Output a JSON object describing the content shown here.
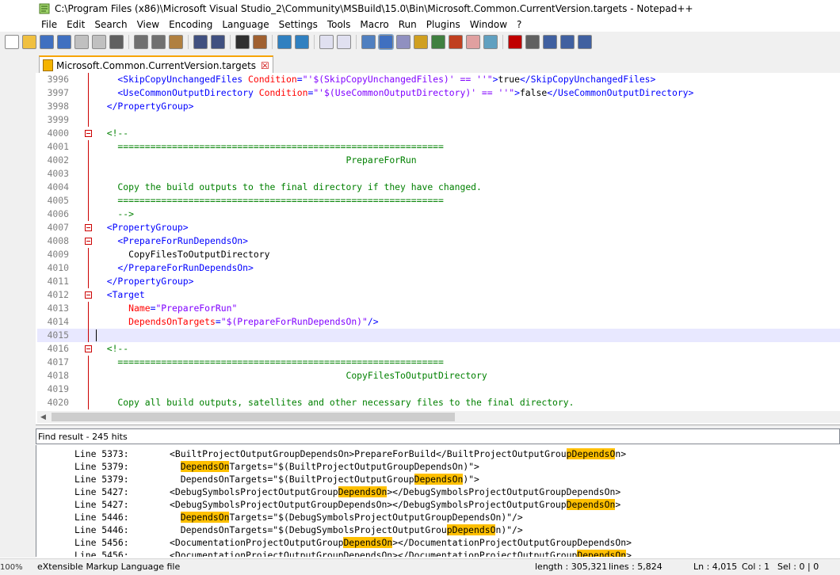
{
  "window": {
    "title": "C:\\Program Files (x86)\\Microsoft Visual Studio_2\\Community\\MSBuild\\15.0\\Bin\\Microsoft.Common.CurrentVersion.targets - Notepad++"
  },
  "menu": [
    "File",
    "Edit",
    "Search",
    "View",
    "Encoding",
    "Language",
    "Settings",
    "Tools",
    "Macro",
    "Run",
    "Plugins",
    "Window",
    "?"
  ],
  "toolbar": {
    "icons": [
      "new-file-icon",
      "open-file-icon",
      "save-icon",
      "save-all-icon",
      "close-icon",
      "close-all-icon",
      "print-icon",
      "cut-icon",
      "copy-icon",
      "paste-icon",
      "undo-icon",
      "redo-icon",
      "find-icon",
      "replace-icon",
      "zoom-in-icon",
      "zoom-out-icon",
      "sync-vertical-icon",
      "sync-horizontal-icon",
      "word-wrap-icon",
      "show-all-chars-icon",
      "indent-guide-icon",
      "language-icon",
      "doc-map-icon",
      "function-list-icon",
      "folder-workspace-icon",
      "monitoring-icon",
      "record-macro-icon",
      "stop-record-icon",
      "play-macro-icon",
      "run-macro-multiple-icon",
      "save-macro-icon"
    ]
  },
  "tab": {
    "label": "Microsoft.Common.CurrentVersion.targets"
  },
  "editor": {
    "lines": [
      {
        "n": "3996",
        "fold": "line",
        "parts": [
          {
            "c": "tag",
            "t": "    <SkipCopyUnchangedFiles "
          },
          {
            "c": "attr",
            "t": "Condition"
          },
          {
            "c": "tag",
            "t": "="
          },
          {
            "c": "val",
            "t": "\"'$(SkipCopyUnchangedFiles)' == ''\""
          },
          {
            "c": "tag",
            "t": ">"
          },
          {
            "c": "txt",
            "t": "true"
          },
          {
            "c": "tag",
            "t": "</SkipCopyUnchangedFiles>"
          }
        ]
      },
      {
        "n": "3997",
        "fold": "line",
        "parts": [
          {
            "c": "tag",
            "t": "    <UseCommonOutputDirectory "
          },
          {
            "c": "attr",
            "t": "Condition"
          },
          {
            "c": "tag",
            "t": "="
          },
          {
            "c": "val",
            "t": "\"'$(UseCommonOutputDirectory)' == ''\""
          },
          {
            "c": "tag",
            "t": ">"
          },
          {
            "c": "txt",
            "t": "false"
          },
          {
            "c": "tag",
            "t": "</UseCommonOutputDirectory>"
          }
        ]
      },
      {
        "n": "3998",
        "fold": "line",
        "parts": [
          {
            "c": "tag",
            "t": "  </PropertyGroup>"
          }
        ]
      },
      {
        "n": "3999",
        "fold": "line",
        "parts": []
      },
      {
        "n": "4000",
        "fold": "box",
        "parts": [
          {
            "c": "cmt",
            "t": "  <!--"
          }
        ]
      },
      {
        "n": "4001",
        "fold": "line",
        "parts": [
          {
            "c": "cmt",
            "t": "    ============================================================"
          }
        ]
      },
      {
        "n": "4002",
        "fold": "line",
        "parts": [
          {
            "c": "cmt",
            "t": "                                              PrepareForRun"
          }
        ]
      },
      {
        "n": "4003",
        "fold": "line",
        "parts": []
      },
      {
        "n": "4004",
        "fold": "line",
        "parts": [
          {
            "c": "cmt",
            "t": "    Copy the build outputs to the final directory if they have changed."
          }
        ]
      },
      {
        "n": "4005",
        "fold": "line",
        "parts": [
          {
            "c": "cmt",
            "t": "    ============================================================"
          }
        ]
      },
      {
        "n": "4006",
        "fold": "line",
        "parts": [
          {
            "c": "cmt",
            "t": "    -->"
          }
        ]
      },
      {
        "n": "4007",
        "fold": "box",
        "parts": [
          {
            "c": "tag",
            "t": "  <PropertyGroup>"
          }
        ]
      },
      {
        "n": "4008",
        "fold": "box",
        "parts": [
          {
            "c": "tag",
            "t": "    <PrepareForRunDependsOn>"
          }
        ]
      },
      {
        "n": "4009",
        "fold": "line",
        "parts": [
          {
            "c": "txt",
            "t": "      CopyFilesToOutputDirectory"
          }
        ]
      },
      {
        "n": "4010",
        "fold": "line",
        "parts": [
          {
            "c": "tag",
            "t": "    </PrepareForRunDependsOn>"
          }
        ]
      },
      {
        "n": "4011",
        "fold": "line",
        "parts": [
          {
            "c": "tag",
            "t": "  </PropertyGroup>"
          }
        ]
      },
      {
        "n": "4012",
        "fold": "box",
        "parts": [
          {
            "c": "tag",
            "t": "  <Target"
          }
        ]
      },
      {
        "n": "4013",
        "fold": "line",
        "parts": [
          {
            "c": "attr",
            "t": "      Name"
          },
          {
            "c": "tag",
            "t": "="
          },
          {
            "c": "val",
            "t": "\"PrepareForRun\""
          }
        ]
      },
      {
        "n": "4014",
        "fold": "line",
        "parts": [
          {
            "c": "attr",
            "t": "      DependsOnTargets"
          },
          {
            "c": "tag",
            "t": "="
          },
          {
            "c": "val",
            "t": "\"$(PrepareForRunDependsOn)\""
          },
          {
            "c": "tag",
            "t": "/>"
          }
        ]
      },
      {
        "n": "4015",
        "fold": "line",
        "cur": true,
        "parts": []
      },
      {
        "n": "4016",
        "fold": "box",
        "parts": [
          {
            "c": "cmt",
            "t": "  <!--"
          }
        ]
      },
      {
        "n": "4017",
        "fold": "line",
        "parts": [
          {
            "c": "cmt",
            "t": "    ============================================================"
          }
        ]
      },
      {
        "n": "4018",
        "fold": "line",
        "parts": [
          {
            "c": "cmt",
            "t": "                                              CopyFilesToOutputDirectory"
          }
        ]
      },
      {
        "n": "4019",
        "fold": "line",
        "parts": []
      },
      {
        "n": "4020",
        "fold": "line",
        "parts": [
          {
            "c": "cmt",
            "t": "    Copy all build outputs, satellites and other necessary files to the final directory."
          }
        ]
      }
    ]
  },
  "find": {
    "header": "Find result - 245 hits",
    "term": "DependsOn",
    "results": [
      {
        "line": "Line 5373:",
        "code": "<BuiltProjectOutputGroupDependsOn>PrepareForBuild</BuiltProjectOutputGroupDependsOn>",
        "hl": [
          [
            73,
            82
          ]
        ]
      },
      {
        "line": "Line 5379:",
        "code": "  DependsOnTargets=\"$(BuiltProjectOutputGroupDependsOn)\">",
        "hl": [
          [
            2,
            11
          ]
        ]
      },
      {
        "line": "Line 5379:",
        "code": "  DependsOnTargets=\"$(BuiltProjectOutputGroupDependsOn)\">",
        "hl": [
          [
            45,
            54
          ]
        ]
      },
      {
        "line": "Line 5427:",
        "code": "<DebugSymbolsProjectOutputGroupDependsOn></DebugSymbolsProjectOutputGroupDependsOn>",
        "hl": [
          [
            31,
            40
          ]
        ]
      },
      {
        "line": "Line 5427:",
        "code": "<DebugSymbolsProjectOutputGroupDependsOn></DebugSymbolsProjectOutputGroupDependsOn>",
        "hl": [
          [
            73,
            82
          ]
        ]
      },
      {
        "line": "Line 5446:",
        "code": "  DependsOnTargets=\"$(DebugSymbolsProjectOutputGroupDependsOn)\"/>",
        "hl": [
          [
            2,
            11
          ]
        ]
      },
      {
        "line": "Line 5446:",
        "code": "  DependsOnTargets=\"$(DebugSymbolsProjectOutputGroupDependsOn)\"/>",
        "hl": [
          [
            51,
            60
          ]
        ]
      },
      {
        "line": "Line 5456:",
        "code": "<DocumentationProjectOutputGroupDependsOn></DocumentationProjectOutputGroupDependsOn>",
        "hl": [
          [
            32,
            41
          ]
        ]
      },
      {
        "line": "Line 5456:",
        "code": "<DocumentationProjectOutputGroupDependsOn></DocumentationProjectOutputGroupDependsOn>",
        "hl": [
          [
            75,
            84
          ]
        ]
      }
    ]
  },
  "status": {
    "zoom": "100%",
    "type": "eXtensible Markup Language file",
    "length": "length : 305,321",
    "lines": "lines : 5,824",
    "ln": "Ln : 4,015",
    "col": "Col : 1",
    "sel": "Sel : 0 | 0"
  }
}
